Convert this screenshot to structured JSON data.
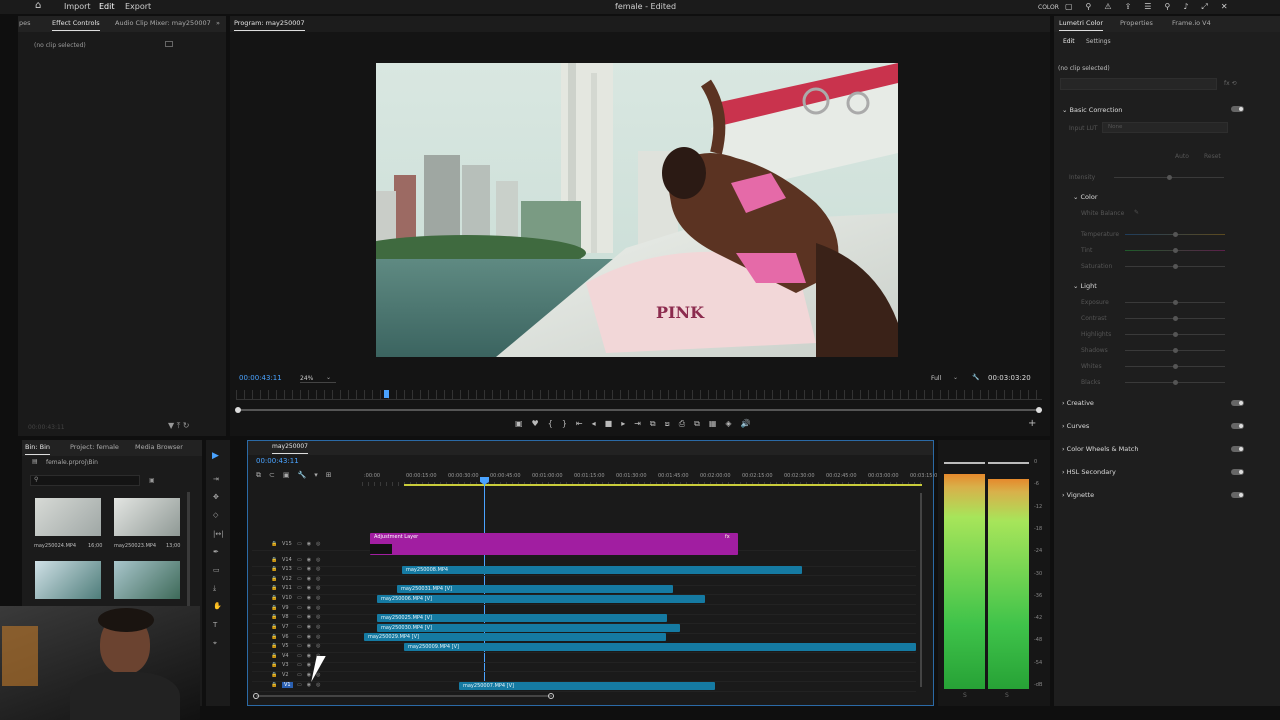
{
  "menubar": {
    "home_icon": "home-icon",
    "items": [
      "Import",
      "Edit",
      "Export"
    ],
    "title": "female - Edited",
    "workspace": "COLOR"
  },
  "effect_controls": {
    "tabs": [
      "pes",
      "Effect Controls",
      "Audio Clip Mixer: may250007"
    ],
    "no_clip": "(no clip selected)",
    "timecode": "00:00:43:11"
  },
  "program": {
    "tab": "Program: may250007",
    "timecode": "00:00:43:11",
    "zoom": "24%",
    "quality": "Full",
    "duration": "00:03:03:20"
  },
  "lumetri": {
    "tabs": [
      "Lumetri Color",
      "Properties",
      "Frame.io V4"
    ],
    "subtabs": [
      "Edit",
      "Settings"
    ],
    "no_clip": "(no clip selected)",
    "basic_correction": "Basic Correction",
    "input_lut_label": "Input LUT",
    "input_lut_value": "None",
    "auto": "Auto",
    "reset": "Reset",
    "intensity": "Intensity",
    "color": "Color",
    "white_balance": "White Balance",
    "color_sliders": [
      "Temperature",
      "Tint",
      "Saturation"
    ],
    "light": "Light",
    "light_sliders": [
      "Exposure",
      "Contrast",
      "Highlights",
      "Shadows",
      "Whites",
      "Blacks"
    ],
    "sections": [
      "Creative",
      "Curves",
      "Color Wheels & Match",
      "HSL Secondary",
      "Vignette"
    ]
  },
  "bin": {
    "tabs": [
      "Bin: Bin",
      "Project: female",
      "Media Browser"
    ],
    "path": "female.prproj\\Bin",
    "items": [
      {
        "name": "may250024.MP4",
        "duration": "16;00"
      },
      {
        "name": "may250023.MP4",
        "duration": "13;00"
      }
    ]
  },
  "timeline": {
    "tab": "may250007",
    "timecode": "00:00:43:11",
    "ruler": [
      ":00:00",
      "00:00:15:00",
      "00:00:30:00",
      "00:00:45:00",
      "00:01:00:00",
      "00:01:15:00",
      "00:01:30:00",
      "00:01:45:00",
      "00:02:00:00",
      "00:02:15:00",
      "00:02:30:00",
      "00:02:45:00",
      "00:03:00:00",
      "00:03:15:0"
    ],
    "tracks": [
      "V15",
      "V14",
      "V13",
      "V12",
      "V11",
      "V10",
      "V9",
      "V8",
      "V7",
      "V6",
      "V5",
      "V4",
      "V3",
      "V2",
      "V1"
    ],
    "clips": {
      "adjustment": "Adjustment Layer",
      "c1": "may250008.MP4",
      "c2": "may250031.MP4 [V]",
      "c3": "may250006.MP4 [V]",
      "c4": "may250025.MP4 [V]",
      "c5": "may250030.MP4 [V]",
      "c6": "may250029.MP4 [V]",
      "c7": "may250009.MP4 [V]",
      "c8": "may250007.MP4 [V]"
    }
  },
  "meter": {
    "scale": [
      "0",
      "-6",
      "-12",
      "-18",
      "-24",
      "-30",
      "-36",
      "-42",
      "-48",
      "-54",
      "-dB"
    ],
    "channels": [
      "S",
      "S"
    ]
  }
}
